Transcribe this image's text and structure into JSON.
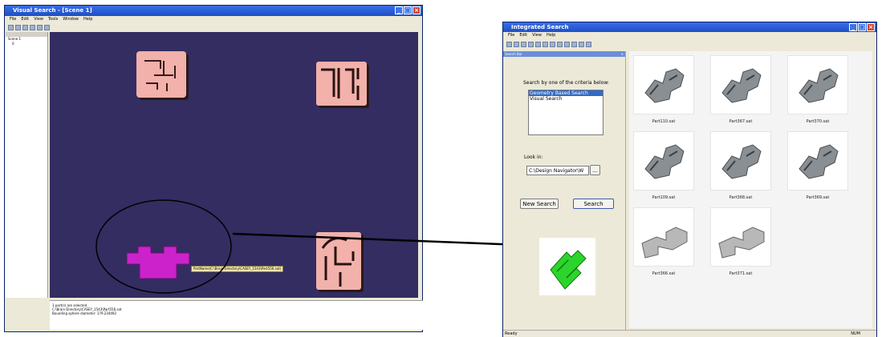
{
  "visual_search": {
    "title": "Visual Search - [Scene 1]",
    "menu": [
      "File",
      "Edit",
      "View",
      "Tools",
      "Window",
      "Help"
    ],
    "tree_items": [
      "Scene 1",
      "0",
      "Scene 1"
    ],
    "tooltip": "PartName(C:\\Brain Directory\\CASEY_1543\\Part556.sat)",
    "log_lines": [
      "1 part(s) are selected",
      "C:\\Brain Directory\\CASEY_1543\\Part556.sat",
      "Bounding sphere diameter: 179.234492"
    ]
  },
  "integrated_search": {
    "title": "Integrated Search",
    "menu": [
      "File",
      "Edit",
      "View",
      "Help"
    ],
    "panel_tab": "Search Bar",
    "criteria_label": "Search by one of the criteria below:",
    "criteria_options": [
      "Geometry Based Search",
      "Visual Search"
    ],
    "selected_criterion": "Geometry Based Search",
    "look_in_label": "Look in:",
    "look_in_value": "C:\\Design Navigator\\W",
    "browse_label": "...",
    "new_search_label": "New Search",
    "search_label": "Search",
    "results": [
      {
        "label": "Part110.sat"
      },
      {
        "label": "Part367.sat"
      },
      {
        "label": "Part370.sat"
      },
      {
        "label": "Part109.sat"
      },
      {
        "label": "Part368.sat"
      },
      {
        "label": "Part369.sat"
      },
      {
        "label": "Part366.sat"
      },
      {
        "label": "Part371.sat"
      }
    ],
    "status_left": "Ready",
    "status_right": "NUM"
  },
  "colors": {
    "viewport_bg": "#332d62",
    "part_pink": "#f2b1aa",
    "part_selected": "#cc22cc",
    "query_green": "#2cd42c",
    "title_blue": "#2456d8"
  }
}
